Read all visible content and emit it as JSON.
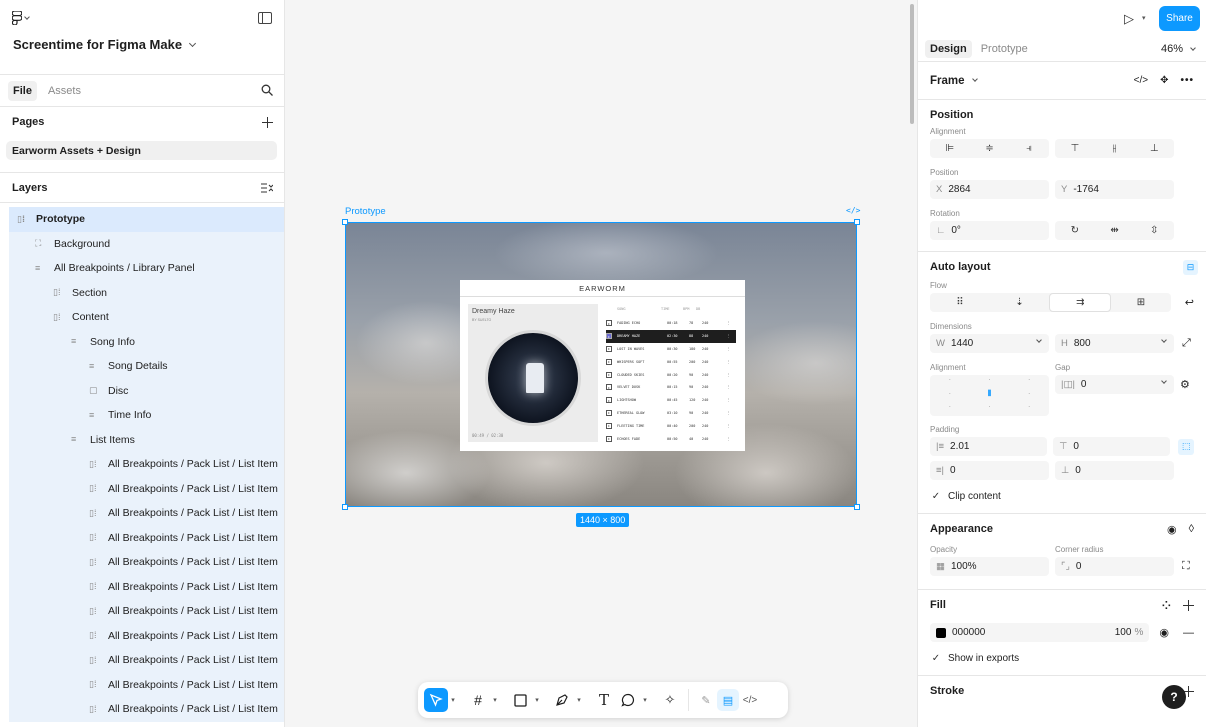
{
  "file": {
    "name": "Screentime for Figma Make"
  },
  "left_tabs": [
    "File",
    "Assets"
  ],
  "pages": {
    "title": "Pages",
    "items": [
      "Earworm Assets + Design"
    ]
  },
  "layers": {
    "title": "Layers",
    "items": [
      {
        "label": "Prototype",
        "indent": 0,
        "icon": "frame"
      },
      {
        "label": "Background",
        "indent": 1,
        "icon": "image"
      },
      {
        "label": "All Breakpoints / Library Panel",
        "indent": 1,
        "icon": "stack"
      },
      {
        "label": "Section",
        "indent": 2,
        "icon": "frame"
      },
      {
        "label": "Content",
        "indent": 2,
        "icon": "frame"
      },
      {
        "label": "Song Info",
        "indent": 3,
        "icon": "stack"
      },
      {
        "label": "Song Details",
        "indent": 4,
        "icon": "stack"
      },
      {
        "label": "Disc",
        "indent": 4,
        "icon": "box"
      },
      {
        "label": "Time Info",
        "indent": 4,
        "icon": "stack"
      },
      {
        "label": "List Items",
        "indent": 3,
        "icon": "stack"
      },
      {
        "label": "All Breakpoints / Pack List / List Item",
        "indent": 4,
        "icon": "frame"
      },
      {
        "label": "All Breakpoints / Pack List / List Item",
        "indent": 4,
        "icon": "frame"
      },
      {
        "label": "All Breakpoints / Pack List / List Item",
        "indent": 4,
        "icon": "frame"
      },
      {
        "label": "All Breakpoints / Pack List / List Item",
        "indent": 4,
        "icon": "frame"
      },
      {
        "label": "All Breakpoints / Pack List / List Item",
        "indent": 4,
        "icon": "frame"
      },
      {
        "label": "All Breakpoints / Pack List / List Item",
        "indent": 4,
        "icon": "frame"
      },
      {
        "label": "All Breakpoints / Pack List / List Item",
        "indent": 4,
        "icon": "frame"
      },
      {
        "label": "All Breakpoints / Pack List / List Item",
        "indent": 4,
        "icon": "frame"
      },
      {
        "label": "All Breakpoints / Pack List / List Item",
        "indent": 4,
        "icon": "frame"
      },
      {
        "label": "All Breakpoints / Pack List / List Item",
        "indent": 4,
        "icon": "frame"
      },
      {
        "label": "All Breakpoints / Pack List / List Item",
        "indent": 4,
        "icon": "frame"
      }
    ]
  },
  "canvas": {
    "frame_label": "Prototype",
    "size_badge": "1440 × 800",
    "app": {
      "title": "EARWORM",
      "song_title": "Dreamy Haze",
      "song_artist": "BY SUELTO",
      "time": "00:49 / 02:30",
      "columns": [
        "SONG",
        "TIME",
        "BPM",
        "DB"
      ],
      "rows": [
        [
          "FADING ECHO",
          "00:18",
          "78",
          "240"
        ],
        [
          "DREAMY HAZE",
          "02:30",
          "88",
          "240"
        ],
        [
          "LOST IN WAVES",
          "00:30",
          "180",
          "240"
        ],
        [
          "WHISPERS SOFT",
          "00:55",
          "200",
          "240"
        ],
        [
          "CLOUDED SKIES",
          "00:20",
          "90",
          "240"
        ],
        [
          "VELVET DUSK",
          "00:15",
          "90",
          "240"
        ],
        [
          "LIGHTSHOW",
          "00:45",
          "120",
          "240"
        ],
        [
          "ETHEREAL GLOW",
          "03:10",
          "90",
          "240"
        ],
        [
          "FLEETING TIME",
          "00:40",
          "200",
          "240"
        ],
        [
          "ECHOES FADE",
          "00:50",
          "40",
          "240"
        ]
      ],
      "highlight_row": 1
    }
  },
  "right": {
    "share_label": "Share",
    "tabs": [
      "Design",
      "Prototype"
    ],
    "zoom": "46%",
    "selection_type": "Frame",
    "position": {
      "title": "Position",
      "alignment_label": "Alignment",
      "position_label": "Position",
      "x_label": "X",
      "x": "2864",
      "y_label": "Y",
      "y": "-1764",
      "rotation_label": "Rotation",
      "rotation": "0°"
    },
    "auto_layout": {
      "title": "Auto layout",
      "flow_label": "Flow",
      "dimensions_label": "Dimensions",
      "w_label": "W",
      "w": "1440",
      "h_label": "H",
      "h": "800",
      "alignment_label": "Alignment",
      "gap_label": "Gap",
      "gap": "0",
      "padding_label": "Padding",
      "pad_left": "2.01",
      "pad_top": "0",
      "pad_right": "0",
      "pad_bottom": "0",
      "clip_label": "Clip content"
    },
    "appearance": {
      "title": "Appearance",
      "opacity_label": "Opacity",
      "opacity": "100%",
      "radius_label": "Corner radius",
      "radius": "0"
    },
    "fill": {
      "title": "Fill",
      "hex": "000000",
      "opacity": "100",
      "pct": "%",
      "color": "#000000",
      "export_label": "Show in exports"
    },
    "stroke": {
      "title": "Stroke"
    }
  },
  "colors": {
    "accent": "#0d99ff"
  }
}
